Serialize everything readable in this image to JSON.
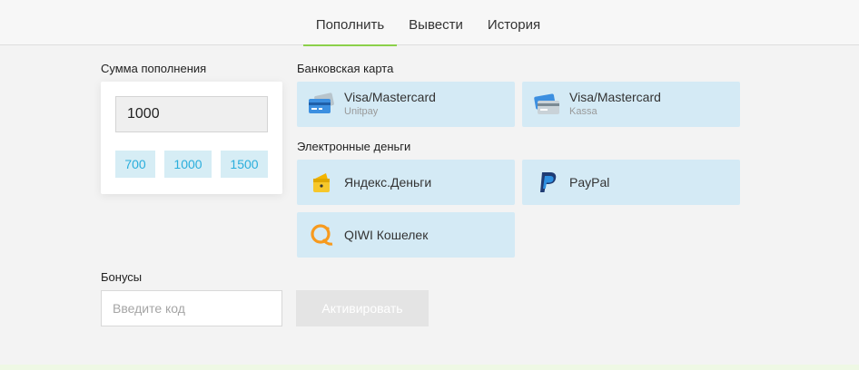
{
  "tabs": [
    {
      "label": "Пополнить",
      "active": true
    },
    {
      "label": "Вывести",
      "active": false
    },
    {
      "label": "История",
      "active": false
    }
  ],
  "amount": {
    "title": "Сумма пополнения",
    "value": "1000",
    "presets": [
      "700",
      "1000",
      "1500"
    ]
  },
  "bank_card": {
    "title": "Банковская карта",
    "methods": [
      {
        "name": "Visa/Mastercard",
        "provider": "Unitpay",
        "icon": "credit-card-icon"
      },
      {
        "name": "Visa/Mastercard",
        "provider": "Kassa",
        "icon": "credit-card-icon"
      }
    ]
  },
  "emoney": {
    "title": "Электронные деньги",
    "methods": [
      {
        "name": "Яндекс.Деньги",
        "icon": "yandex-money-icon"
      },
      {
        "name": "PayPal",
        "icon": "paypal-icon"
      },
      {
        "name": "QIWI Кошелек",
        "icon": "qiwi-icon"
      }
    ]
  },
  "bonus": {
    "title": "Бонусы",
    "placeholder": "Введите код",
    "button_label": "Активировать"
  },
  "colors": {
    "accent_green": "#8bd04a",
    "method_bg": "#d4eaf5",
    "preset_text": "#2aaedc"
  }
}
